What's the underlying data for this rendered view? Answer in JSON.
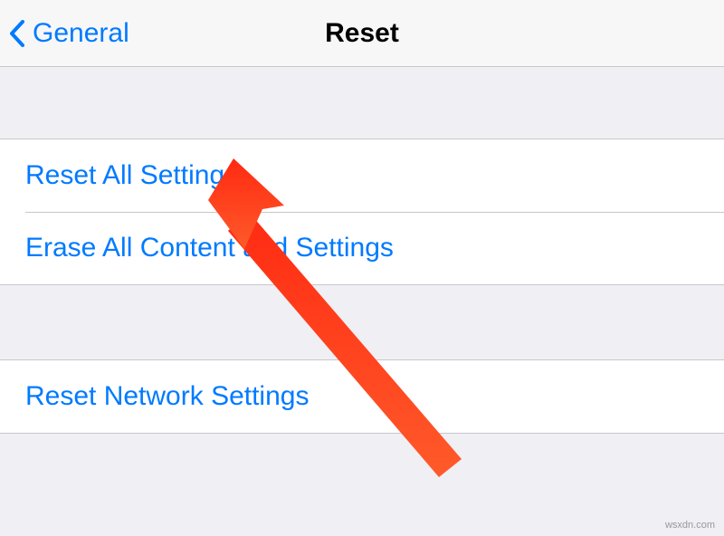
{
  "nav": {
    "back_label": "General",
    "title": "Reset"
  },
  "groups": [
    {
      "rows": [
        {
          "label": "Reset All Settings"
        },
        {
          "label": "Erase All Content and Settings"
        }
      ]
    },
    {
      "rows": [
        {
          "label": "Reset Network Settings"
        }
      ]
    }
  ],
  "watermark": "wsxdn.com",
  "colors": {
    "link": "#007aff",
    "arrow": "#ff2a12"
  }
}
